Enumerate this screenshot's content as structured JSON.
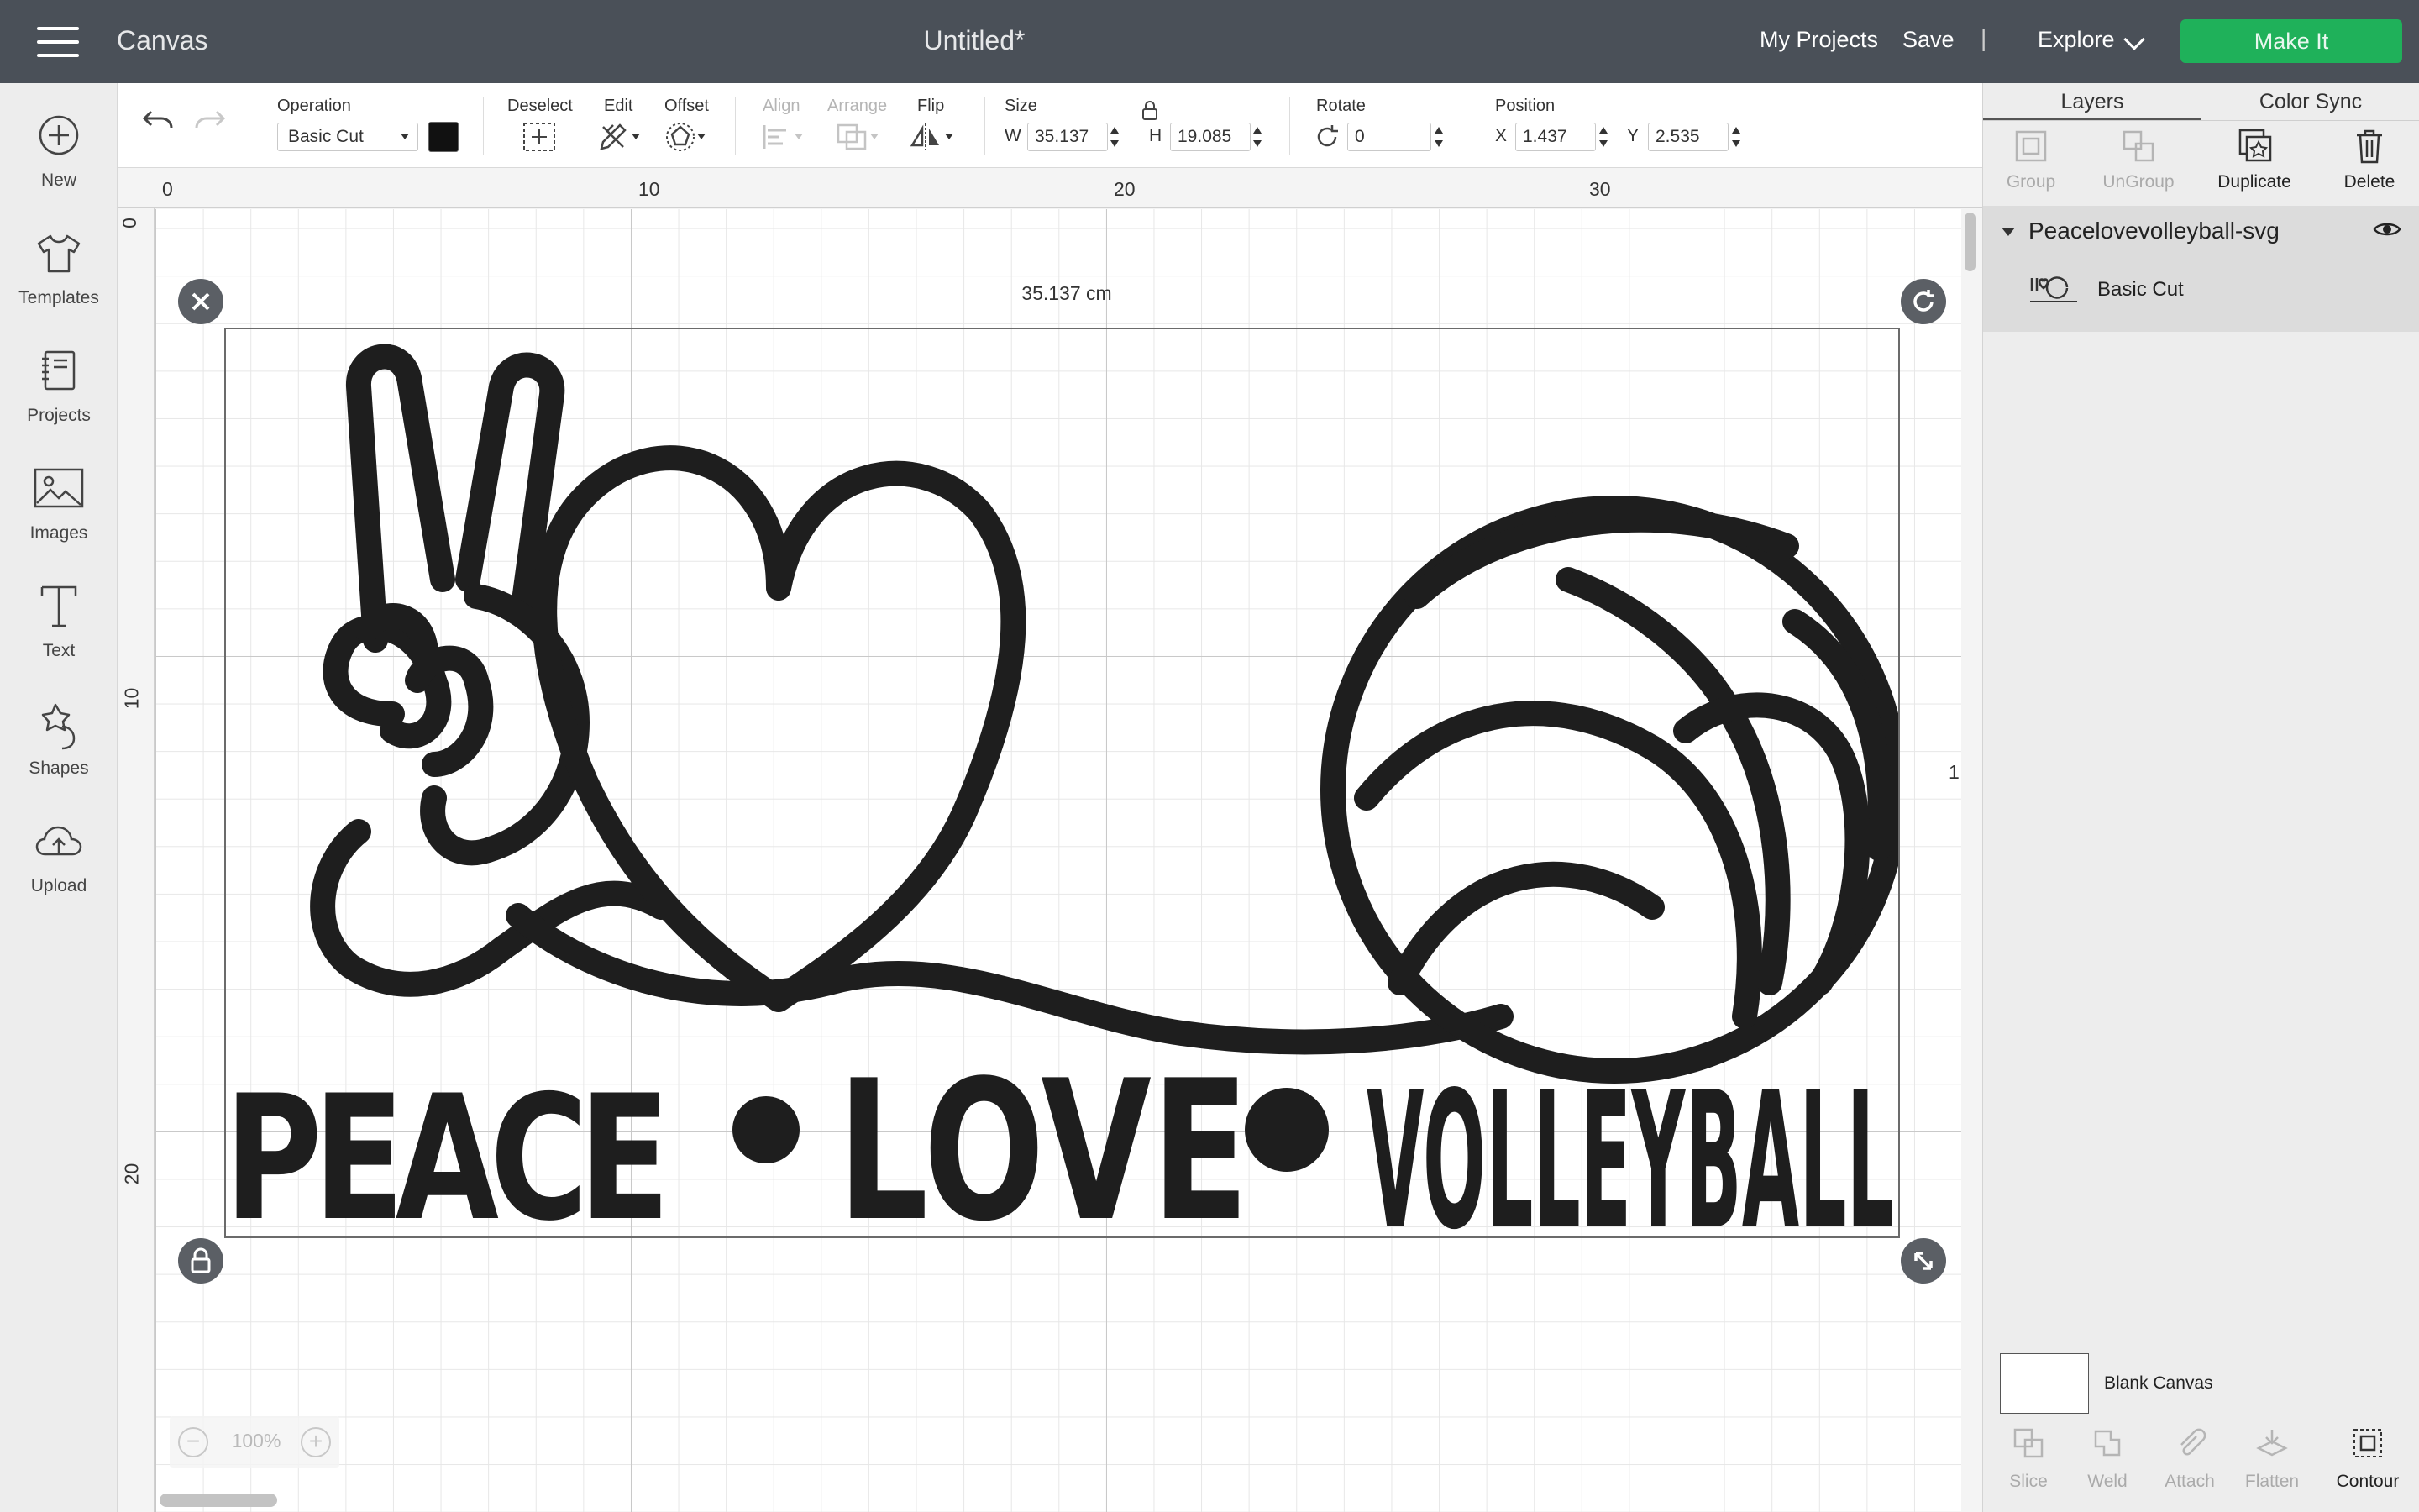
{
  "topbar": {
    "app_title": "Canvas",
    "doc_title": "Untitled*",
    "my_projects": "My Projects",
    "save": "Save",
    "separator": "|",
    "explore": "Explore",
    "make_it": "Make It",
    "colors": {
      "bar": "#4a5058",
      "make_it": "#1fb15a"
    }
  },
  "sidebar": {
    "items": [
      {
        "label": "New",
        "icon": "plus-circle-icon"
      },
      {
        "label": "Templates",
        "icon": "tshirt-icon"
      },
      {
        "label": "Projects",
        "icon": "notebook-icon"
      },
      {
        "label": "Images",
        "icon": "image-icon"
      },
      {
        "label": "Text",
        "icon": "text-t-icon"
      },
      {
        "label": "Shapes",
        "icon": "shapes-icon"
      },
      {
        "label": "Upload",
        "icon": "cloud-upload-icon"
      }
    ]
  },
  "toolbar": {
    "operation_label": "Operation",
    "operation_value": "Basic Cut",
    "deselect_label": "Deselect",
    "edit_label": "Edit",
    "offset_label": "Offset",
    "align_label": "Align",
    "arrange_label": "Arrange",
    "flip_label": "Flip",
    "size_label": "Size",
    "w_label": "W",
    "w_value": "35.137",
    "h_label": "H",
    "h_value": "19.085",
    "rotate_label": "Rotate",
    "rotate_value": "0",
    "position_label": "Position",
    "x_label": "X",
    "x_value": "1.437",
    "y_label": "Y",
    "y_value": "2.535"
  },
  "canvas": {
    "ruler_top": [
      "0",
      "10",
      "20",
      "30"
    ],
    "ruler_left": [
      "0",
      "10",
      "20"
    ],
    "width_label": "35.137 cm",
    "side_mark": "1",
    "zoom_value": "100%",
    "zoom_minus": "−",
    "zoom_plus": "+",
    "design_text": {
      "peace": "PEACE",
      "love": "LOVE",
      "volleyball": "VOLLEYBALL"
    }
  },
  "panel": {
    "tabs": [
      "Layers",
      "Color Sync"
    ],
    "actions": [
      {
        "label": "Group",
        "enabled": false
      },
      {
        "label": "UnGroup",
        "enabled": false
      },
      {
        "label": "Duplicate",
        "enabled": true
      },
      {
        "label": "Delete",
        "enabled": true
      }
    ],
    "layer_group": "Peacelovevolleyball-svg",
    "layer_item": "Basic Cut",
    "blank_canvas": "Blank Canvas",
    "bottom_tools": [
      {
        "label": "Slice",
        "enabled": false
      },
      {
        "label": "Weld",
        "enabled": false
      },
      {
        "label": "Attach",
        "enabled": false
      },
      {
        "label": "Flatten",
        "enabled": false
      },
      {
        "label": "Contour",
        "enabled": true
      }
    ]
  }
}
